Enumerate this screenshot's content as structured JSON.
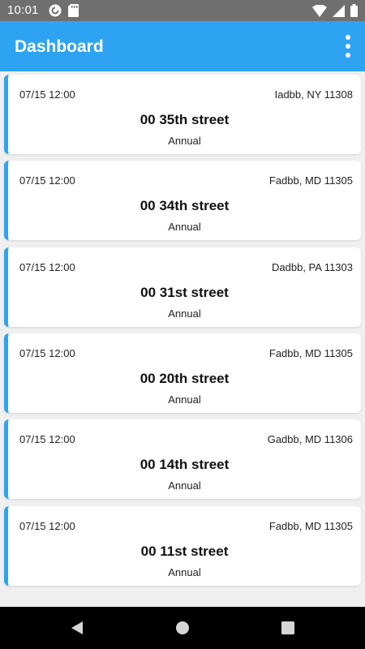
{
  "status_bar": {
    "time": "10:01",
    "left_icons": [
      "pocket-casts-icon",
      "sd-card-icon"
    ],
    "right_icons": [
      "wifi-icon",
      "cell-signal-icon",
      "battery-icon"
    ]
  },
  "app_bar": {
    "title": "Dashboard",
    "overflow_icon": "more-vert-icon"
  },
  "colors": {
    "accent": "#2ea3f2",
    "status_bar": "#6f6f6f",
    "background": "#efefef",
    "nav_bar": "#000000"
  },
  "cards": [
    {
      "date": "07/15 12:00",
      "location": "Iadbb, NY 11308",
      "street": "00 35th street",
      "type": "Annual"
    },
    {
      "date": "07/15 12:00",
      "location": "Fadbb, MD 11305",
      "street": "00 34th street",
      "type": "Annual"
    },
    {
      "date": "07/15 12:00",
      "location": "Dadbb, PA 11303",
      "street": "00 31st street",
      "type": "Annual"
    },
    {
      "date": "07/15 12:00",
      "location": "Fadbb, MD 11305",
      "street": "00 20th street",
      "type": "Annual"
    },
    {
      "date": "07/15 12:00",
      "location": "Gadbb, MD 11306",
      "street": "00 14th street",
      "type": "Annual"
    },
    {
      "date": "07/15 12:00",
      "location": "Fadbb, MD 11305",
      "street": "00 11st street",
      "type": "Annual"
    }
  ],
  "nav_bar": {
    "buttons": [
      "back-icon",
      "home-icon",
      "recents-icon"
    ]
  }
}
